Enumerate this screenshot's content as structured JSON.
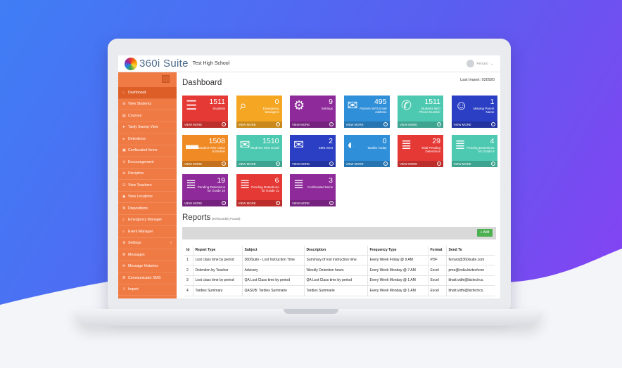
{
  "app": {
    "logo_text": "360i Suite",
    "school": "Test High School",
    "user": "Ferraro"
  },
  "colors": {
    "sidebar": "#f07a44",
    "accent_green": "#4caf50"
  },
  "sidebar": {
    "items": [
      {
        "label": "Dashboard",
        "icon": "home-icon"
      },
      {
        "label": "View Students",
        "icon": "users-icon"
      },
      {
        "label": "Courses",
        "icon": "courses-icon"
      },
      {
        "label": "Tardy Sweep View",
        "icon": "send-icon"
      },
      {
        "label": "Detentions",
        "icon": "detention-icon"
      },
      {
        "label": "Confiscated Items",
        "icon": "box-icon"
      },
      {
        "label": "Encouragement",
        "icon": "trophy-icon"
      },
      {
        "label": "Discipline",
        "icon": "gavel-icon"
      },
      {
        "label": "View Teachers",
        "icon": "check-icon"
      },
      {
        "label": "View Locations",
        "icon": "map-marker-icon"
      },
      {
        "label": "Dispositions",
        "icon": "list-icon"
      },
      {
        "label": "Emergency Manager",
        "icon": "search-icon"
      },
      {
        "label": "Event Manager",
        "icon": "search-icon"
      },
      {
        "label": "Settings",
        "icon": "gear-icon"
      },
      {
        "label": "Messages",
        "icon": "list-icon"
      },
      {
        "label": "Message Histories",
        "icon": "mail-icon"
      },
      {
        "label": "Communicator SMS",
        "icon": "list-icon"
      },
      {
        "label": "Import",
        "icon": "download-icon"
      }
    ]
  },
  "dashboard": {
    "title": "Dashboard",
    "last_import": "Last Import: 020920",
    "view_more": "VIEW MORE"
  },
  "tiles": [
    {
      "value": "1511",
      "label": "Students",
      "color": "#e53935",
      "icon": "users-icon"
    },
    {
      "value": "0",
      "label": "Emergency Managers",
      "color": "#f5a623",
      "icon": "search-icon"
    },
    {
      "value": "9",
      "label": "Settings",
      "color": "#8e2a99",
      "icon": "gear-icon"
    },
    {
      "value": "495",
      "label": "Parents W/O Email Address",
      "color": "#2f8fd8",
      "icon": "mail-icon"
    },
    {
      "value": "1511",
      "label": "Students W/O Phone Number",
      "color": "#4cc9b0",
      "icon": "phone-icon"
    },
    {
      "value": "1",
      "label": "Missing Parent Name",
      "color": "#2a3fc4",
      "icon": "user-icon"
    },
    {
      "value": "1508",
      "label": "Student W/O Class Schedule",
      "color": "#f08a24",
      "icon": "briefcase-icon"
    },
    {
      "value": "1510",
      "label": "Students W/O Email",
      "color": "#4cc9b0",
      "icon": "mail-icon"
    },
    {
      "value": "2",
      "label": "SMS Sent",
      "color": "#2a3fc4",
      "icon": "mail-icon"
    },
    {
      "value": "0",
      "label": "Tardies Today",
      "color": "#2f8fd8",
      "icon": "toggle-icon"
    },
    {
      "value": "29",
      "label": "Total Pending Detentions",
      "color": "#e53935",
      "icon": "list-icon"
    },
    {
      "value": "4",
      "label": "Pending Detentions for Grade 9",
      "color": "#4cc9b0",
      "icon": "list-icon"
    },
    {
      "value": "19",
      "label": "Pending Detentions for Grade 10",
      "color": "#8e2a99",
      "icon": "list-icon"
    },
    {
      "value": "6",
      "label": "Pending Detentions for Grade 11",
      "color": "#e53935",
      "icon": "list-icon"
    },
    {
      "value": "3",
      "label": "Confiscated Items",
      "color": "#8e2a99",
      "icon": "list-icon"
    }
  ],
  "reports": {
    "title": "Reports",
    "subtitle": "(8 Record(s) Found)",
    "add_label": "+ Add",
    "columns": [
      "Id",
      "Report Type",
      "Subject",
      "Description",
      "Frequency Type",
      "Format",
      "Send To"
    ],
    "rows": [
      [
        "1",
        "Lost class time by period",
        "360iSuite - Lost Instruction Time",
        "Summary of lost instruction time.",
        "Every Week Friday @ 9 AM",
        "PDF",
        "ferraro@360isuite.com"
      ],
      [
        "2",
        "Detention by Teacher",
        "Advisory",
        "Weekly Detention hours",
        "Every Week Monday @ 7 AM",
        "Excel",
        "pme@india.biztechcon"
      ],
      [
        "3",
        "Lost class time by period",
        "QA Lost Class time by period",
        "QA Lost Class time by period",
        "Every Week Monday @ 1 AM",
        "Excel",
        "bhatt.vidhi@biztechcs."
      ],
      [
        "4",
        "Tardies Summary",
        "QASUB: Tardies Summarie",
        "Tardies Summarie",
        "Every Week Monday @ 1 AM",
        "Excel",
        "bhatt.vidhi@biztechcs."
      ]
    ]
  }
}
